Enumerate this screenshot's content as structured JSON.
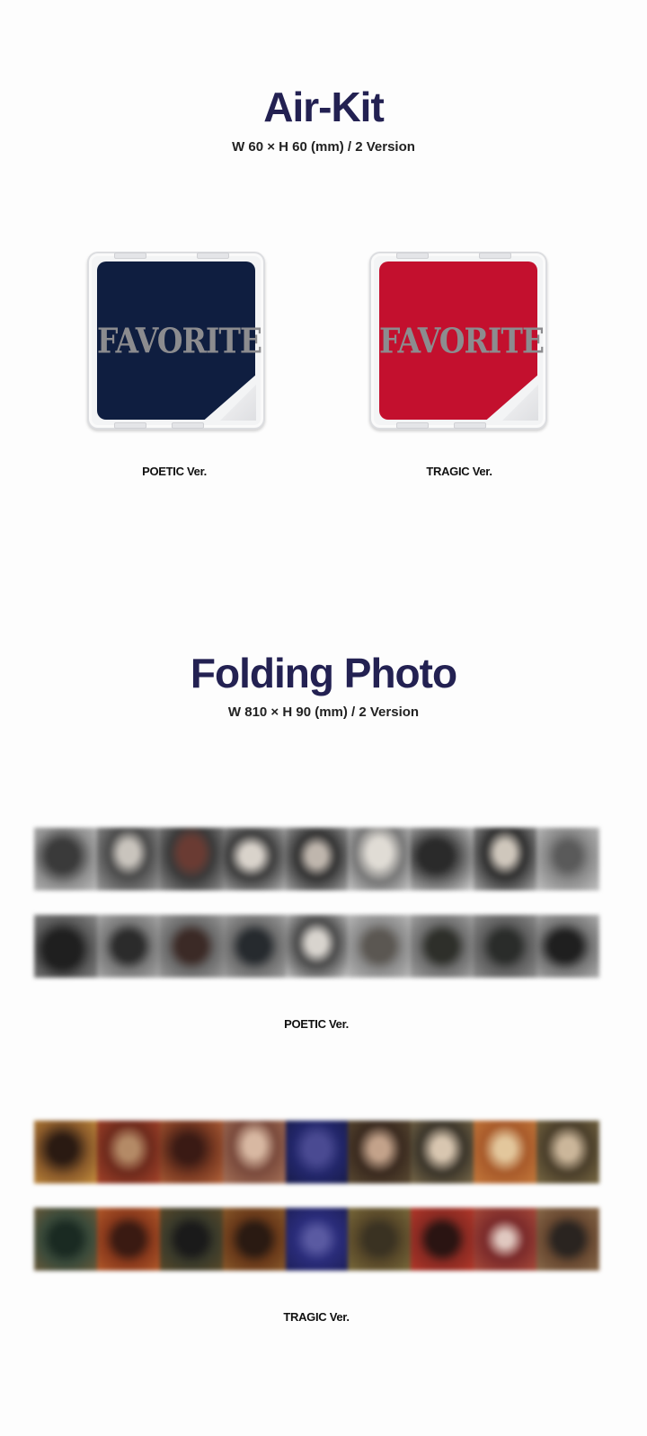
{
  "air_kit": {
    "title": "Air-Kit",
    "spec": "W 60 × H 60 (mm) / 2 Version",
    "versions": [
      {
        "logo": "FAVORITE",
        "caption": "POETIC Ver.",
        "color": "#0f1e40"
      },
      {
        "logo": "FAVORITE",
        "caption": "TRAGIC Ver.",
        "color": "#c3102e"
      }
    ]
  },
  "folding_photo": {
    "title": "Folding Photo",
    "spec": "W 810 × H 90 (mm) / 2 Version",
    "poetic_caption": "POETIC Ver.",
    "tragic_caption": "TRAGIC Ver."
  }
}
